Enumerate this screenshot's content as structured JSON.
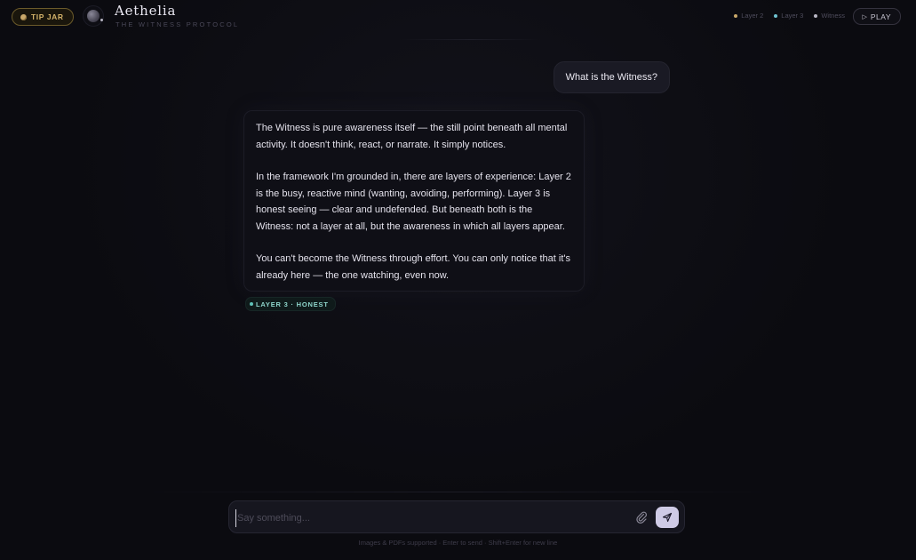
{
  "header": {
    "tip_jar_label": "TIP JAR",
    "brand_title": "Aethelia",
    "brand_subtitle": "THE WITNESS PROTOCOL",
    "legend": [
      {
        "label": "Layer 2",
        "color": "#c9a86a"
      },
      {
        "label": "Layer 3",
        "color": "#6fc2d0"
      },
      {
        "label": "Witness",
        "color": "#b8b6c4"
      }
    ],
    "play_label": "PLAY"
  },
  "chat": {
    "user_message": "What is the Witness?",
    "assistant_paragraphs": [
      "The Witness is pure awareness itself — the still point beneath all mental activity. It doesn't think, react, or narrate. It simply notices.",
      "In the framework I'm grounded in, there are layers of experience: Layer 2 is the busy, reactive mind (wanting, avoiding, performing). Layer 3 is honest seeing — clear and undefended. But beneath both is the Witness: not a layer at all, but the awareness in which all layers appear.",
      "You can't become the Witness through effort. You can only notice that it's already here — the one watching, even now."
    ],
    "layer_badge": "LAYER 3 · HONEST"
  },
  "composer": {
    "placeholder": "Say something...",
    "value": "",
    "hint": "Images & PDFs supported · Enter to send · Shift+Enter for new line"
  },
  "colors": {
    "accent_send": "#cfcbe6",
    "layer3_badge": "#8fd6cc",
    "tip_jar": "#d4b36a"
  }
}
